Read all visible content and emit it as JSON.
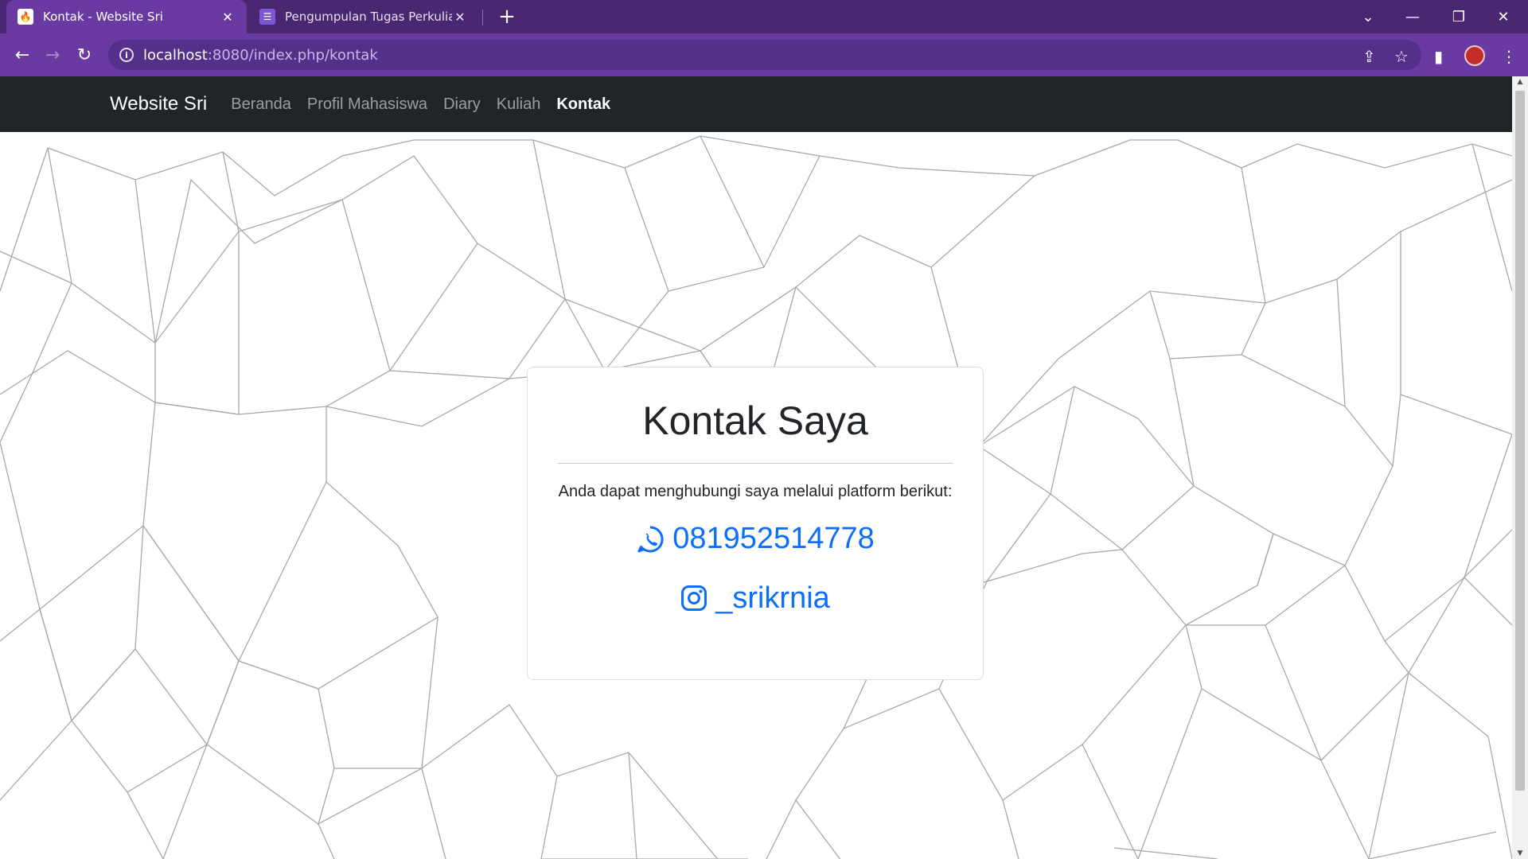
{
  "browser": {
    "tabs": [
      {
        "title": "Kontak - Website Sri",
        "active": true
      },
      {
        "title": "Pengumpulan Tugas Perkuliahan",
        "active": false
      }
    ],
    "url_host": "localhost",
    "url_path": ":8080/index.php/kontak"
  },
  "navbar": {
    "brand": "Website Sri",
    "links": [
      "Beranda",
      "Profil Mahasiswa",
      "Diary",
      "Kuliah",
      "Kontak"
    ],
    "active": "Kontak"
  },
  "card": {
    "title": "Kontak Saya",
    "description": "Anda dapat menghubungi saya melalui platform berikut:",
    "whatsapp": "081952514778",
    "instagram": "_srikrnia"
  },
  "colors": {
    "tabstrip": "#4a2770",
    "toolbar": "#6a3aa3",
    "navbar": "#212529",
    "link": "#0d6efd"
  }
}
